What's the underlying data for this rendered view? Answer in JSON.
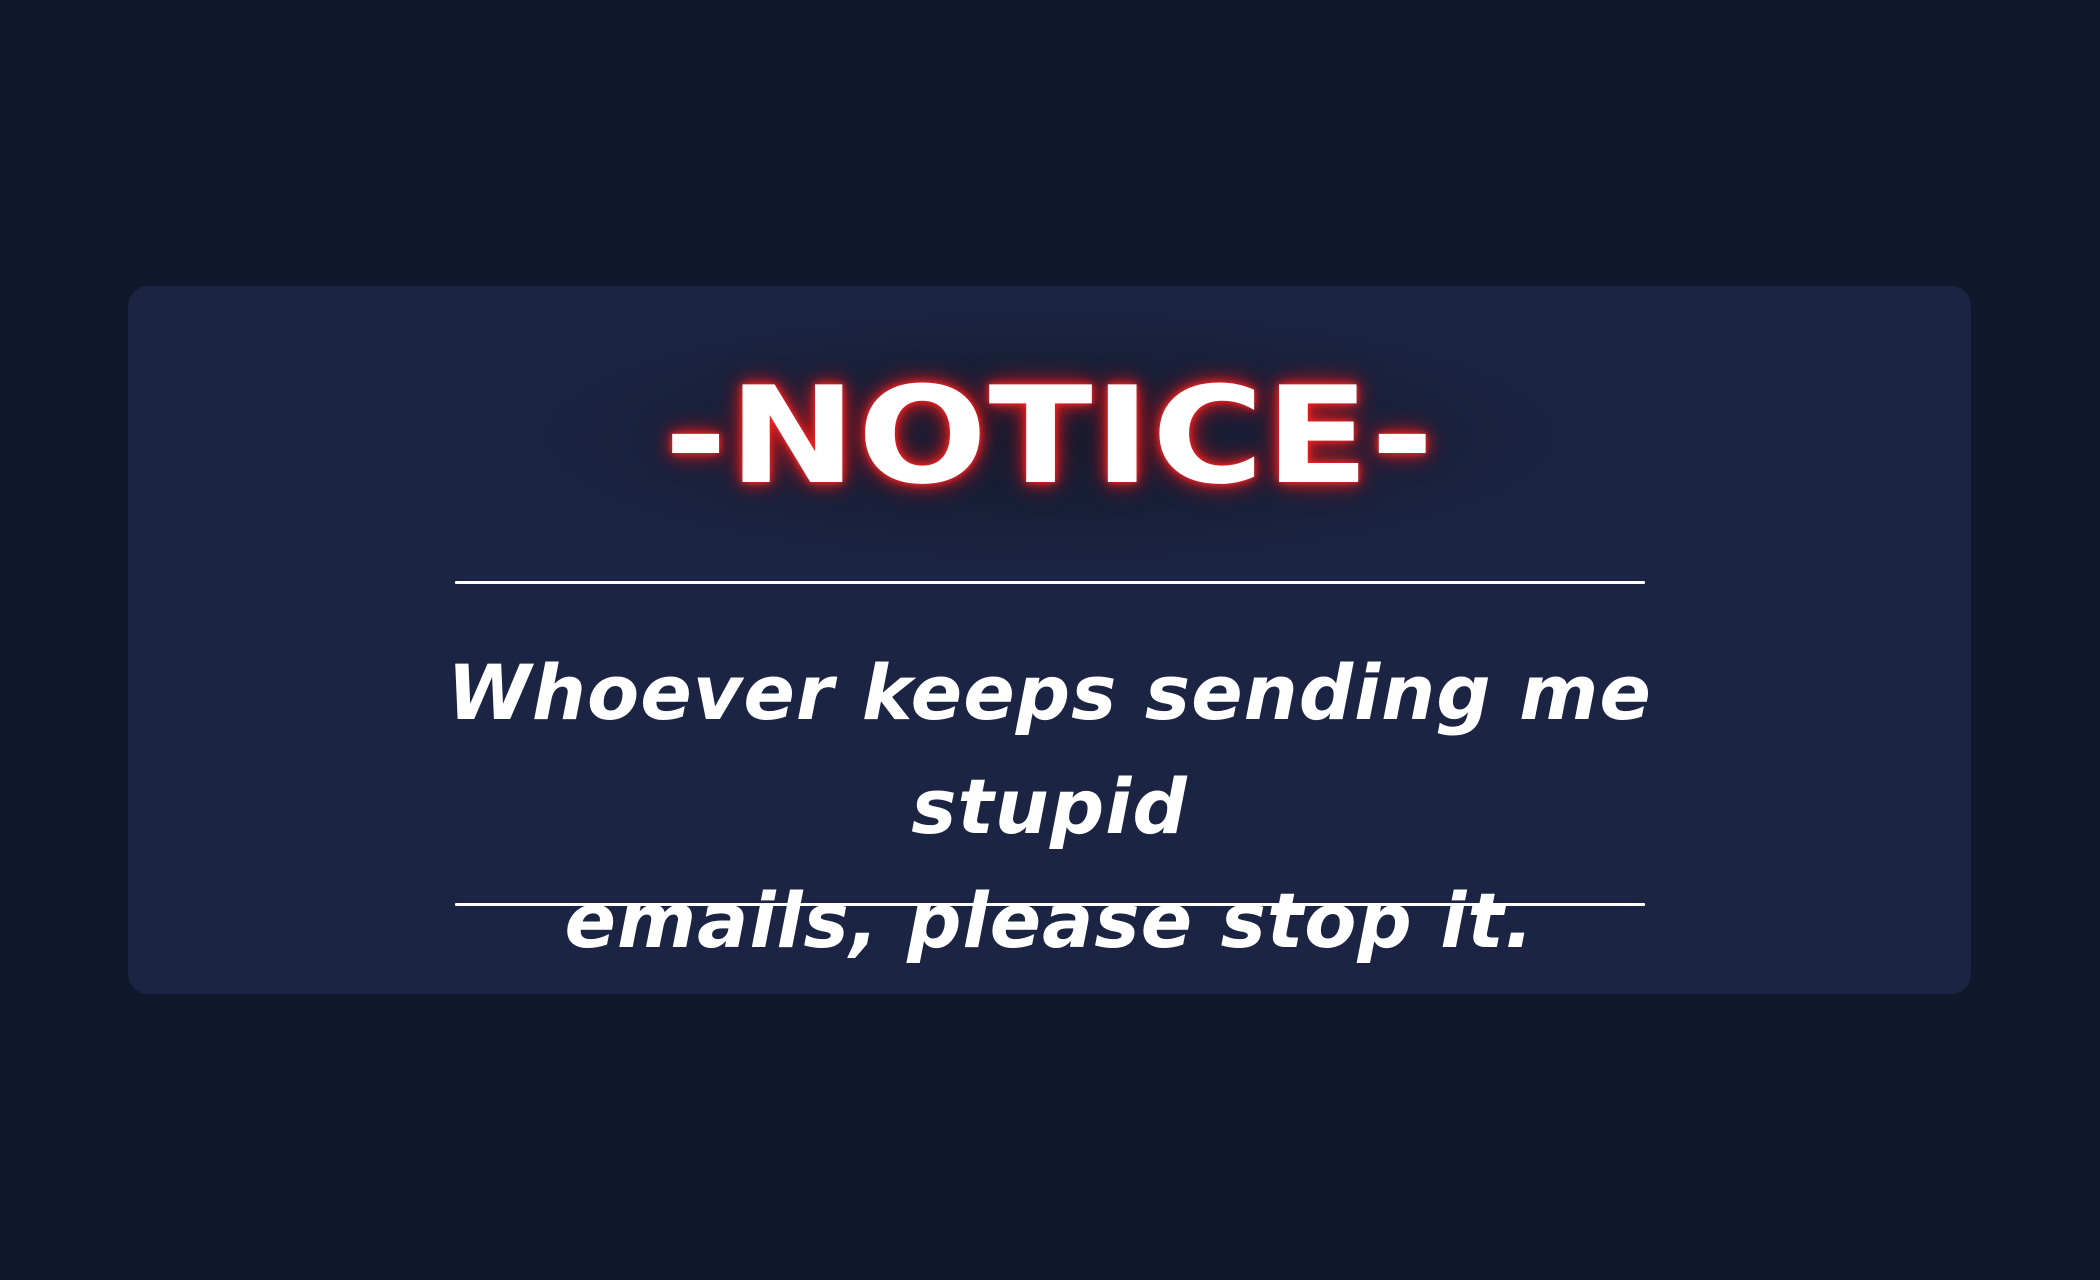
{
  "notice": {
    "title": "-NOTICE-",
    "message_line_1": "Whoever keeps sending me stupid",
    "message_line_2": "emails, please stop it."
  },
  "colors": {
    "background": "#11182b",
    "card": "#1b2442",
    "text": "#ffffff",
    "glow": "#e11d1d",
    "rule": "#ffffff"
  }
}
